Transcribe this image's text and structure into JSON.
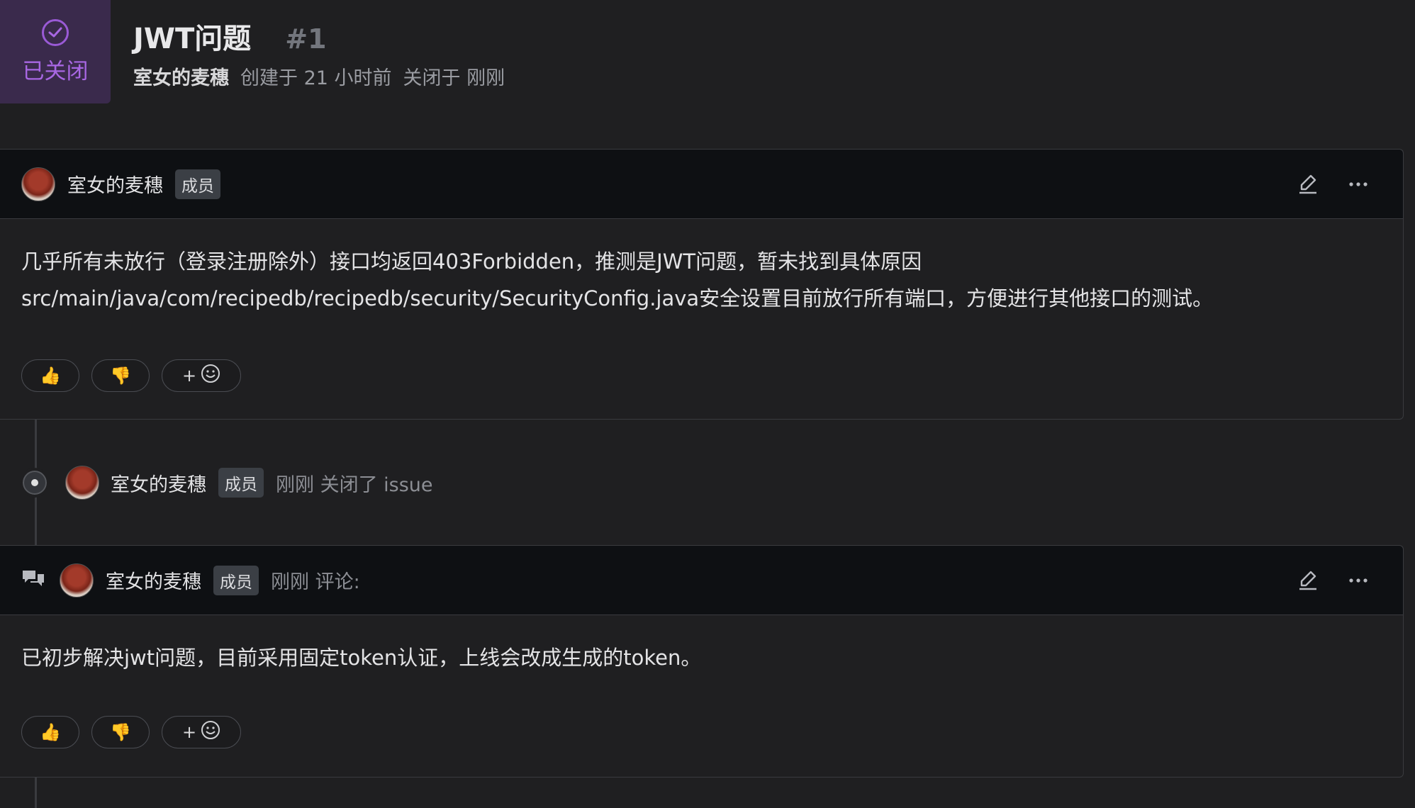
{
  "issue": {
    "status": "已关闭",
    "title": "JWT问题",
    "number": "#1",
    "author": "室女的麦穗",
    "created": "创建于 21 小时前",
    "closed": "关闭于 刚刚"
  },
  "post": {
    "username": "室女的麦穗",
    "badge": "成员",
    "line1": "几乎所有未放行（登录注册除外）接口均返回403Forbidden，推测是JWT问题，暂未找到具体原因",
    "line2": "src/main/java/com/recipedb/recipedb/security/SecurityConfig.java安全设置目前放行所有端口，方便进行其他接口的测试。",
    "reactions": {
      "thumbs_up": "👍",
      "thumbs_down": "👎",
      "add": "+"
    }
  },
  "event": {
    "username": "室女的麦穗",
    "badge": "成员",
    "text": "刚刚 关闭了 issue"
  },
  "comment": {
    "username": "室女的麦穗",
    "badge": "成员",
    "meta": "刚刚 评论:",
    "text": "已初步解决jwt问题，目前采用固定token认证，上线会改成生成的token。",
    "reactions": {
      "thumbs_up": "👍",
      "thumbs_down": "👎",
      "add": "+"
    }
  },
  "icons": {
    "status": "check-circle-icon",
    "edit": "pencil-icon",
    "more": "ellipsis-icon",
    "event": "dot-circle-icon",
    "comment": "comment-icon",
    "emoji": "smiley-icon"
  }
}
